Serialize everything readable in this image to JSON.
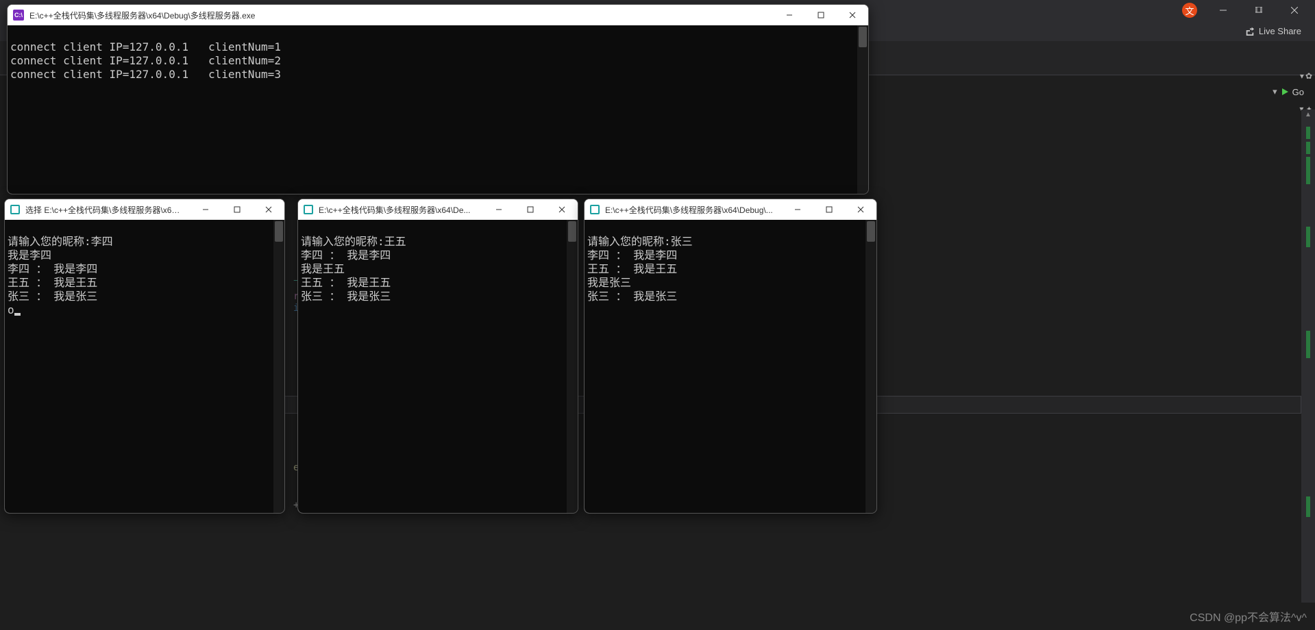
{
  "vs": {
    "ime_label": "文",
    "live_share": "Live Share",
    "go_label": "Go"
  },
  "watermark": "CSDN @pp不会算法^v^",
  "bg_code": {
    "c1": "下",
    "c2": "rS",
    "c3": "it",
    "c4": "(",
    "c5": "eN",
    "c6": "+"
  },
  "server_window": {
    "title": "E:\\c++全栈代码集\\多线程服务器\\x64\\Debug\\多线程服务器.exe",
    "icon_label": "C:\\",
    "lines": [
      "connect client IP=127.0.0.1   clientNum=1",
      "connect client IP=127.0.0.1   clientNum=2",
      "connect client IP=127.0.0.1   clientNum=3"
    ]
  },
  "client1": {
    "title": "选择 E:\\c++全栈代码集\\多线程服务器\\x64\\...",
    "lines": [
      "请输入您的昵称:李四",
      "我是李四",
      "李四 ： 我是李四",
      "王五 ： 我是王五",
      "张三 ： 我是张三",
      "o"
    ]
  },
  "client2": {
    "title": "E:\\c++全栈代码集\\多线程服务器\\x64\\De...",
    "lines": [
      "请输入您的昵称:王五",
      "李四 ： 我是李四",
      "我是王五",
      "王五 ： 我是王五",
      "张三 ： 我是张三"
    ]
  },
  "client3": {
    "title": "E:\\c++全栈代码集\\多线程服务器\\x64\\Debug\\...",
    "lines": [
      "请输入您的昵称:张三",
      "李四 ： 我是李四",
      "王五 ： 我是王五",
      "我是张三",
      "张三 ： 我是张三"
    ]
  }
}
